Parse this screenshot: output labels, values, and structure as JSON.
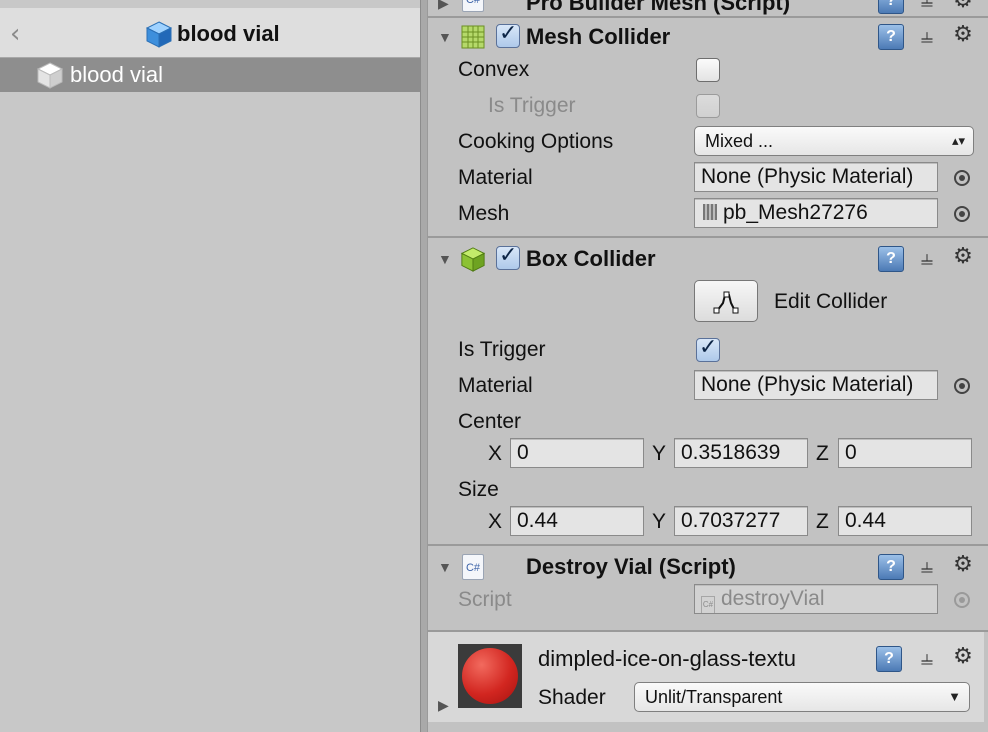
{
  "hierarchy": {
    "title": "blood vial",
    "items": [
      {
        "label": "blood vial",
        "selected": true
      }
    ]
  },
  "inspector": {
    "top_component": {
      "title": "Pro Builder Mesh (Script)"
    },
    "mesh_collider": {
      "title": "Mesh Collider",
      "enabled": true,
      "convex_label": "Convex",
      "convex": false,
      "is_trigger_label": "Is Trigger",
      "is_trigger": false,
      "cooking_options_label": "Cooking Options",
      "cooking_options_value": "Mixed ...",
      "material_label": "Material",
      "material_value": "None (Physic Material)",
      "mesh_label": "Mesh",
      "mesh_value": "pb_Mesh27276"
    },
    "box_collider": {
      "title": "Box Collider",
      "enabled": true,
      "edit_collider_label": "Edit Collider",
      "is_trigger_label": "Is Trigger",
      "is_trigger": true,
      "material_label": "Material",
      "material_value": "None (Physic Material)",
      "center_label": "Center",
      "center": {
        "x": "0",
        "y": "0.3518639",
        "z": "0"
      },
      "size_label": "Size",
      "size": {
        "x": "0.44",
        "y": "0.7037277",
        "z": "0.44"
      },
      "axis_x": "X",
      "axis_y": "Y",
      "axis_z": "Z"
    },
    "destroy_vial": {
      "title": "Destroy Vial (Script)",
      "script_label": "Script",
      "script_value": "destroyVial"
    },
    "material": {
      "name": "dimpled-ice-on-glass-textu",
      "shader_label": "Shader",
      "shader_value": "Unlit/Transparent",
      "preview_color": "#d22620"
    }
  },
  "colors": {
    "panel_bg": "#c2c2c2",
    "selection": "#8e8e8e",
    "accent_blue": "#4c7ab5"
  }
}
